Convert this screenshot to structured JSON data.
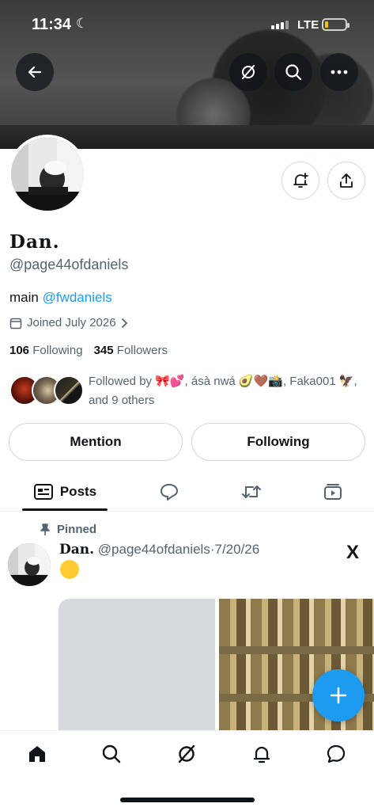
{
  "status_bar": {
    "time": "11:34",
    "network": "LTE"
  },
  "profile": {
    "name": "Dan.",
    "handle": "@page44ofdaniels",
    "bio_prefix": "main",
    "bio_link": "@fwdaniels",
    "joined": "Joined July 2026",
    "following_count": "106",
    "following_label": "Following",
    "followers_count": "345",
    "followers_label": "Followers",
    "followed_by": "Followed by 🎀💕, ásà nwá 🥑🤎📸, Faka001 🦅, and 9 others"
  },
  "buttons": {
    "mention": "Mention",
    "following": "Following"
  },
  "tabs": {
    "posts": "Posts"
  },
  "post": {
    "pinned_label": "Pinned",
    "author_name": "Dan.",
    "author_handle": "@page44ofdaniels",
    "separator": "·",
    "date": "7/20/26",
    "source_logo": "X"
  },
  "icons": [
    "back-arrow-icon",
    "grok-icon",
    "search-icon",
    "more-icon",
    "notification-bell-plus-icon",
    "share-icon",
    "calendar-icon",
    "chevron-right-icon",
    "posts-icon",
    "replies-icon",
    "reposts-icon",
    "media-icon",
    "pin-icon",
    "plus-icon",
    "home-icon",
    "grok-icon",
    "bell-icon",
    "messages-icon"
  ],
  "colors": {
    "accent": "#1d9bf0",
    "text": "#0f1419",
    "muted": "#536471",
    "border": "#cfd9de"
  }
}
